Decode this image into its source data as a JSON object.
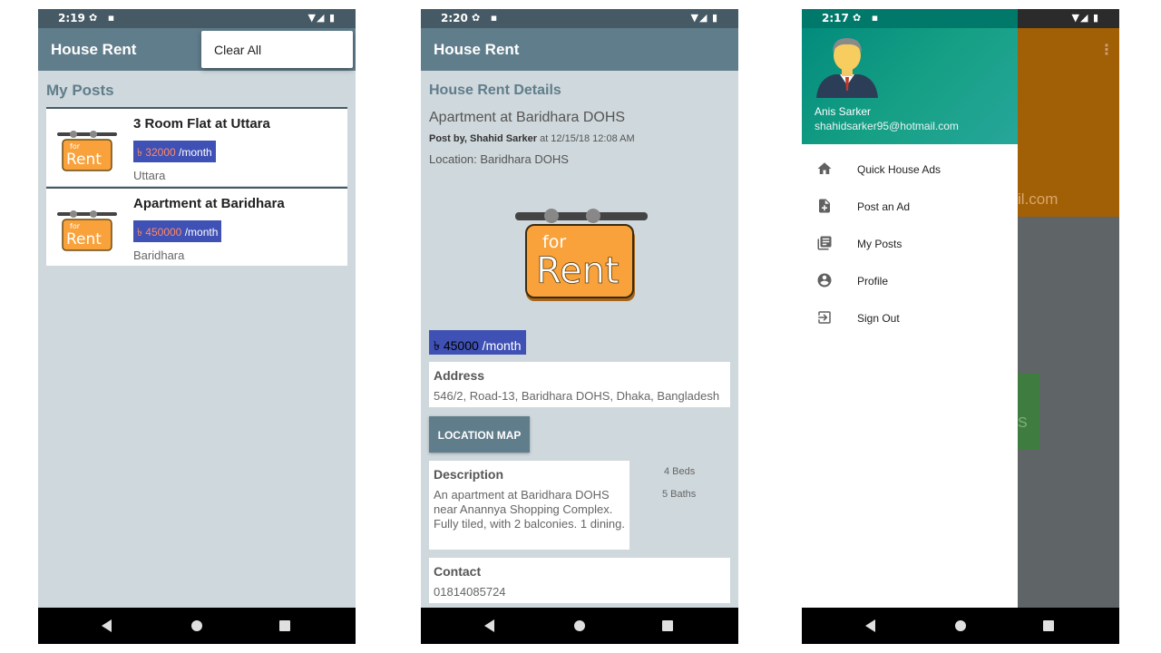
{
  "screens": [
    {
      "status": {
        "time": "2:19"
      },
      "appbar": {
        "title": "House Rent"
      },
      "overflow_menu": {
        "item": "Clear All"
      },
      "section_title": "My Posts",
      "posts": [
        {
          "title": "3 Room Flat at Uttara",
          "price": "৳ 32000",
          "per": " /month",
          "location": "Uttara"
        },
        {
          "title": "Apartment at Baridhara",
          "price": "৳ 450000",
          "per": " /month",
          "location": "Baridhara"
        }
      ],
      "rent_sign": {
        "small": "for",
        "big": "Rent"
      }
    },
    {
      "status": {
        "time": "2:20"
      },
      "appbar": {
        "title": "House Rent"
      },
      "heading": "House Rent Details",
      "title": "Apartment at Baridhara DOHS",
      "post_by_label": "Post by, Shahid Sarker",
      "post_at": " at 12/15/18 12:08 AM",
      "location": "Location: Baridhara DOHS",
      "rent_sign": {
        "small": "for",
        "big": "Rent"
      },
      "price": "৳ 45000",
      "per": " /month",
      "address": {
        "heading": "Address",
        "text": "546/2, Road-13, Baridhara DOHS, Dhaka, Bangladesh"
      },
      "location_map_button": "LOCATION MAP",
      "description": {
        "heading": "Description",
        "text": "An apartment at Baridhara DOHS near Anannya Shopping Complex. Fully tiled, with 2 balconies. 1 dining."
      },
      "beds": "4 Beds",
      "baths": "5 Baths",
      "contact": {
        "heading": "Contact",
        "text": "01814085724"
      }
    },
    {
      "status": {
        "time": "2:17"
      },
      "user": {
        "name": "Anis Sarker",
        "email": "shahidsarker95@hotmail.com"
      },
      "menu": [
        {
          "icon": "home-icon",
          "label": "Quick House Ads"
        },
        {
          "icon": "post-add-icon",
          "label": "Post an Ad"
        },
        {
          "icon": "list-icon",
          "label": "My Posts"
        },
        {
          "icon": "account-circle-icon",
          "label": "Profile"
        },
        {
          "icon": "sign-out-icon",
          "label": "Sign Out"
        }
      ],
      "behind": {
        "email_fragment": "il.com",
        "button_fragment": "S"
      }
    }
  ],
  "colors": {
    "appbar": "#607d8b",
    "statusbar": "#455a64",
    "price_bg": "#3f51b5",
    "price_amount": "#ff8a65",
    "background": "#cfd8dc",
    "drawer_header": "#16a085",
    "rent_sign": "#f9a23b"
  }
}
